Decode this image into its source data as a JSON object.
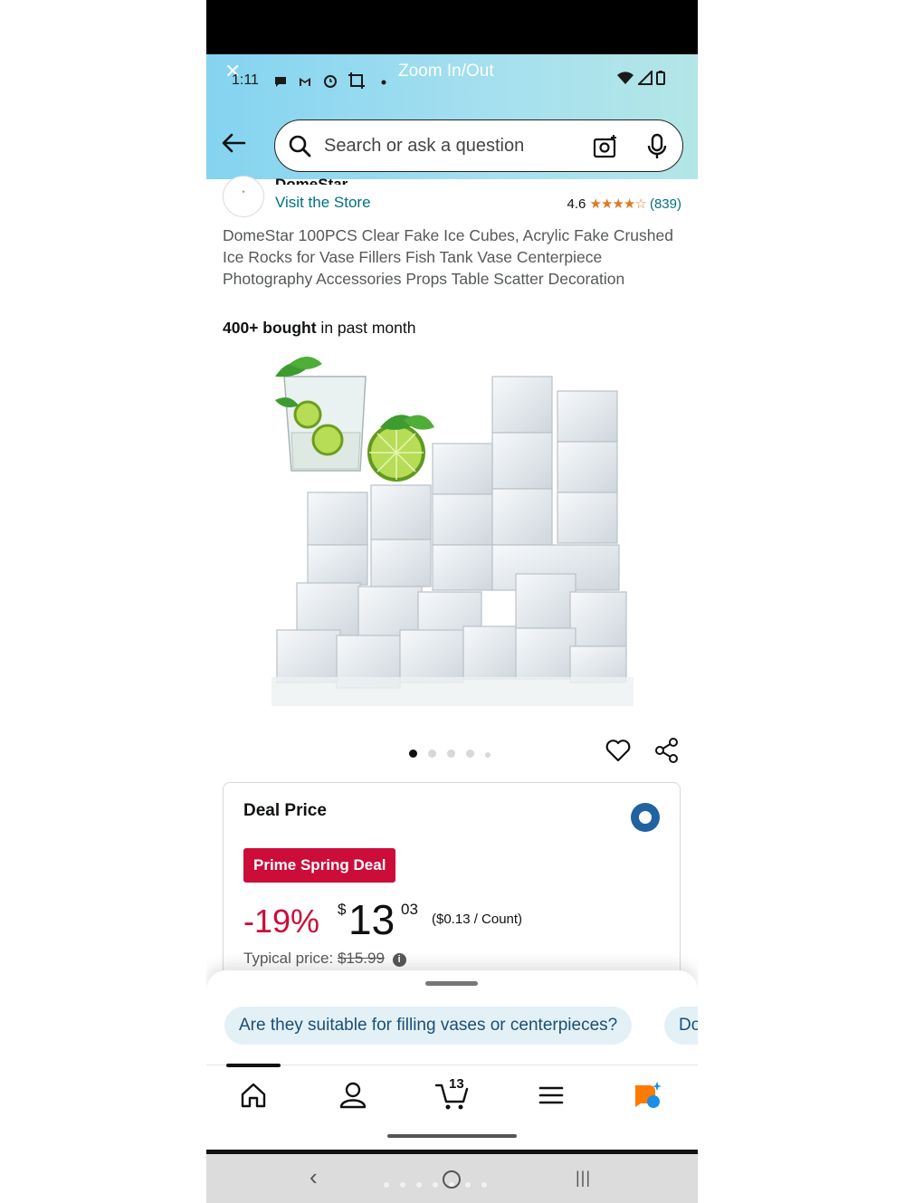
{
  "status_bar": {
    "time": "1:11",
    "overlay_label": "Zoom In/Out",
    "close_glyph": "✕",
    "icons": [
      "message-icon",
      "gmail-icon",
      "alarm-icon",
      "screenshot-icon",
      "dot-icon",
      "wifi-icon",
      "signal-icon",
      "battery-icon"
    ]
  },
  "search": {
    "placeholder": "Search or ask a question"
  },
  "store": {
    "name": "DomeStar",
    "visit_label": "Visit the Store",
    "rating": "4.6",
    "stars": "★★★★☆",
    "review_count": "(839)"
  },
  "product": {
    "title": "DomeStar 100PCS Clear Fake Ice Cubes, Acrylic Fake Crushed Ice Rocks for Vase Fillers Fish Tank Vase Centerpiece Photography Accessories Props Table Scatter Decoration",
    "bought_bold": "400+ bought",
    "bought_rest": " in past month",
    "image_count": 5,
    "active_image": 1
  },
  "deal": {
    "label": "Deal Price",
    "badge": "Prime Spring Deal",
    "discount": "-19%",
    "currency": "$",
    "price_whole": "13",
    "price_fraction": "03",
    "unit_price": "($0.13 / Count)",
    "typical_label": "Typical price:",
    "typical_price": "$15.99",
    "info_glyph": "i"
  },
  "suggestions": {
    "chips": [
      "Are they suitable for filling vases or centerpieces?",
      "Do"
    ]
  },
  "bottom_nav": {
    "cart_count": "13",
    "items": [
      "home-icon",
      "account-icon",
      "cart-icon",
      "menu-icon",
      "rufus-icon"
    ]
  },
  "system_nav": {
    "back": "‹",
    "recents": "|||"
  },
  "colors": {
    "header_gradient_start": "#84d3f0",
    "link": "#007185",
    "deal_red": "#cc0c39",
    "star_orange": "#de7921",
    "radio_blue": "#2162a1"
  }
}
